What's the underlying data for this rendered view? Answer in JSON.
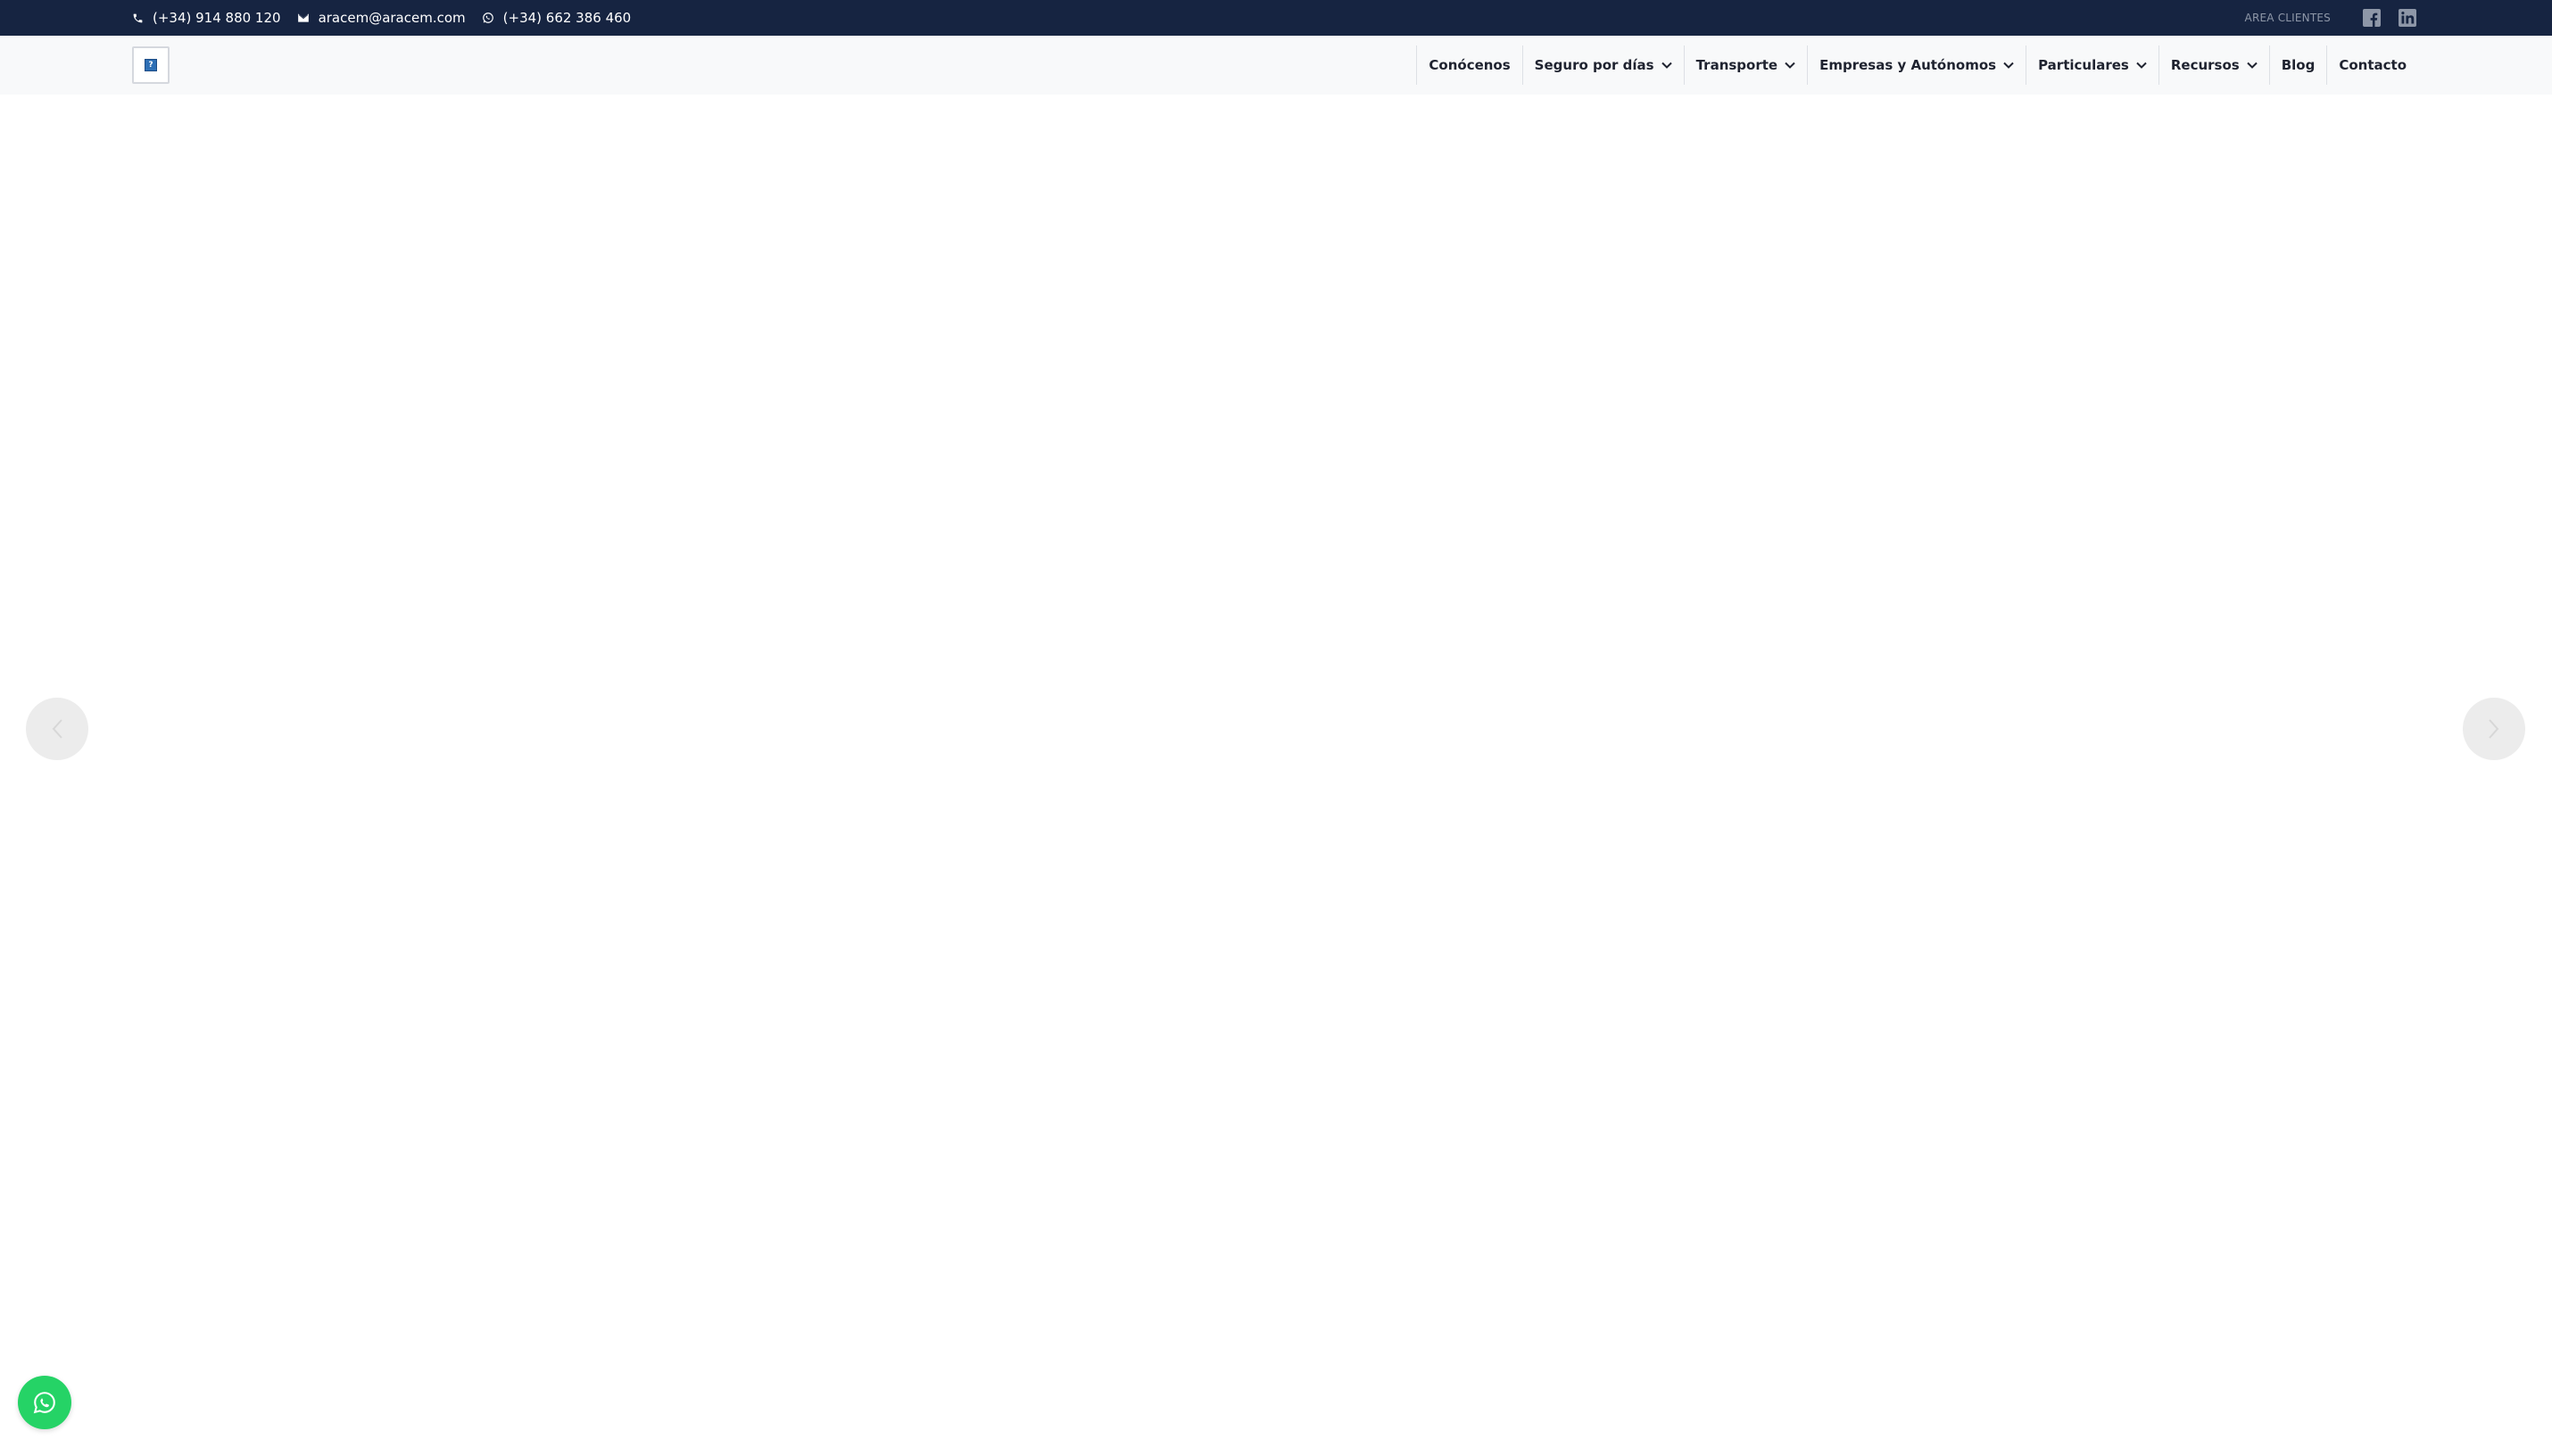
{
  "topbar": {
    "phone": "(+34) 914 880 120",
    "email": "aracem@aracem.com",
    "whatsapp": "(+34) 662 386 460",
    "area_clientes": "AREA CLIENTES",
    "social_icons": [
      "facebook-icon",
      "linkedin-icon"
    ],
    "background": "#162441"
  },
  "nav": {
    "items": [
      {
        "label": "Conócenos",
        "dropdown": false
      },
      {
        "label": "Seguro por días",
        "dropdown": true
      },
      {
        "label": "Transporte",
        "dropdown": true
      },
      {
        "label": "Empresas y Autónomos",
        "dropdown": true
      },
      {
        "label": "Particulares",
        "dropdown": true
      },
      {
        "label": "Recursos",
        "dropdown": true
      },
      {
        "label": "Blog",
        "dropdown": false
      },
      {
        "label": "Contacto",
        "dropdown": false
      }
    ]
  },
  "slider": {
    "prev_icon": "chevron-left-icon",
    "next_icon": "chevron-right-icon"
  },
  "floating": {
    "icon": "whatsapp-icon",
    "color": "#25d366"
  }
}
